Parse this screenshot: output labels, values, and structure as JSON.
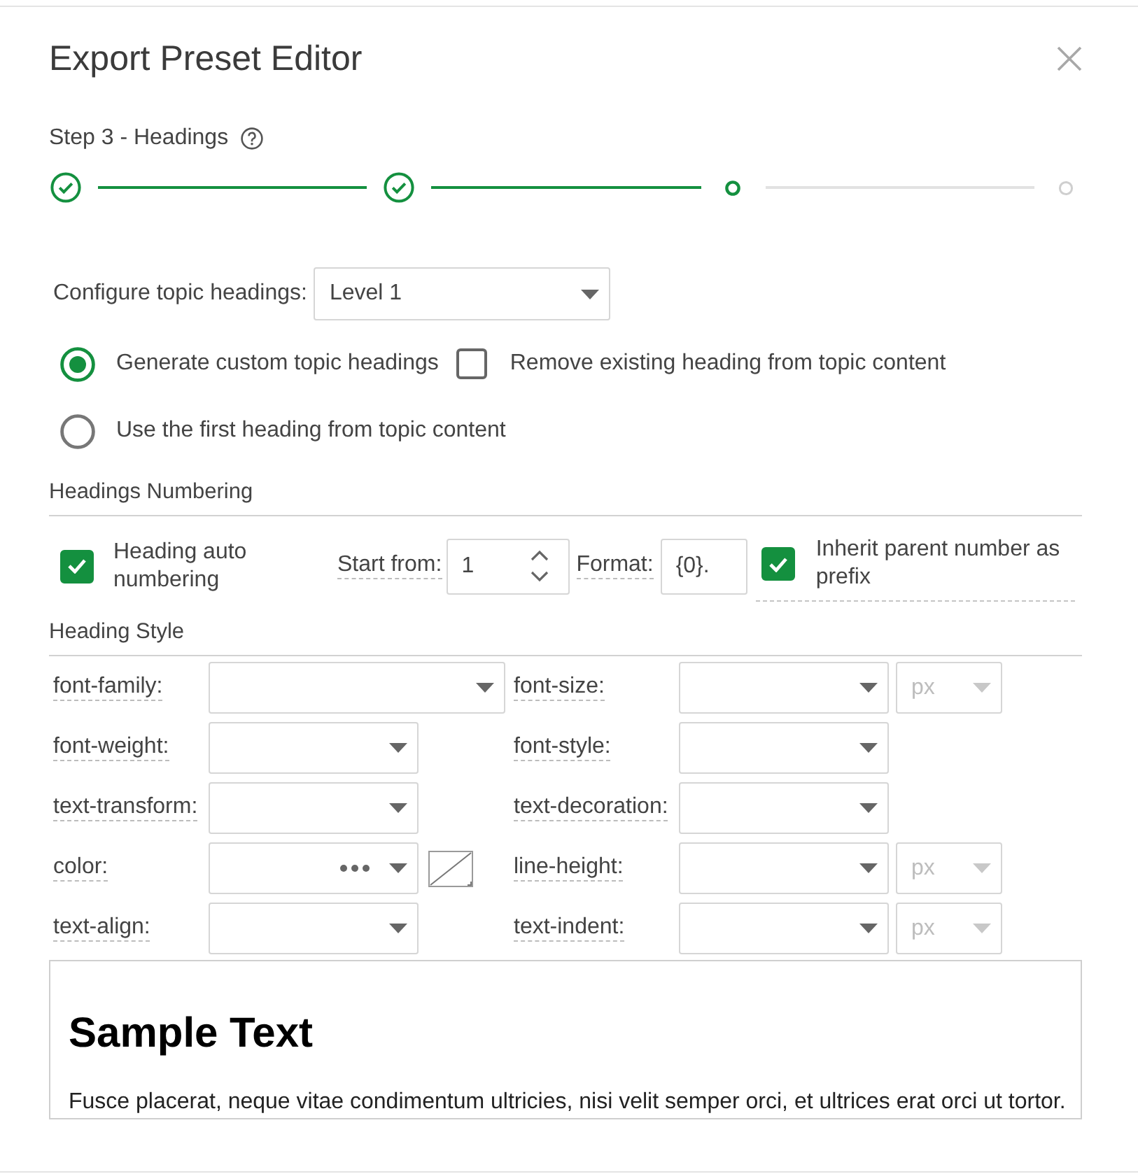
{
  "dialog": {
    "title": "Export Preset Editor"
  },
  "step": {
    "label": "Step 3 - Headings"
  },
  "steps": [
    {
      "completed": true,
      "selected": false
    },
    {
      "completed": true,
      "selected": false
    },
    {
      "completed": false,
      "selected": true
    },
    {
      "completed": false,
      "selected": false
    }
  ],
  "topic_headings": {
    "label": "Configure topic headings:",
    "value": "Level 1"
  },
  "heading_source": [
    {
      "label": "Generate custom topic headings",
      "selected": true,
      "remove_existing_heading": {
        "label": "Remove existing heading from topic content",
        "checked": false
      }
    },
    {
      "label": "Use the first heading from topic content",
      "selected": false
    }
  ],
  "numbering": {
    "title": "Headings Numbering",
    "auto_numbering": {
      "label": "Heading auto numbering",
      "checked": true
    },
    "start_from": {
      "label": "Start from:",
      "value": "1"
    },
    "format": {
      "label": "Format:",
      "value": "{0}."
    },
    "inherit_prefix": {
      "label": "Inherit parent number as prefix",
      "checked": true
    }
  },
  "style": {
    "title": "Heading Style",
    "rows": [
      {
        "left": {
          "label": "font-family:",
          "kind": "combobox"
        },
        "right": {
          "label": "font-size:",
          "kind": "select",
          "unit": {
            "value": "px",
            "disabled": true
          }
        }
      },
      {
        "left": {
          "label": "font-weight:",
          "kind": "select"
        },
        "right": {
          "label": "font-style:",
          "kind": "select"
        }
      },
      {
        "left": {
          "label": "text-transform:",
          "kind": "select"
        },
        "right": {
          "label": "text-decoration:",
          "kind": "select"
        }
      },
      {
        "left": {
          "label": "color:",
          "kind": "color"
        },
        "right": {
          "label": "line-height:",
          "kind": "select",
          "unit": {
            "value": "px",
            "disabled": true
          }
        }
      },
      {
        "left": {
          "label": "text-align:",
          "kind": "select"
        },
        "right": {
          "label": "text-indent:",
          "kind": "select",
          "unit": {
            "value": "px",
            "disabled": true
          }
        }
      }
    ]
  },
  "preview": {
    "heading": "Sample Text",
    "text": "Fusce placerat, neque vitae condimentum ultricies, nisi velit semper orci, et ultrices erat orci ut tortor."
  }
}
